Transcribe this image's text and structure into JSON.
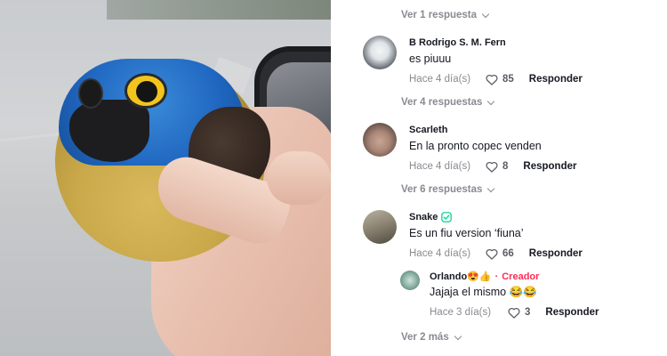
{
  "comments_panel": {
    "view_more": [
      {
        "label": "Ver 1 respuesta"
      },
      {
        "label": "Ver 4 respuestas"
      },
      {
        "label": "Ver 6 respuestas"
      },
      {
        "label": "Ver 2 más"
      }
    ],
    "comments": [
      {
        "author": "B Rodrigo S. M. Fern",
        "text": "es piuuu",
        "date": "Hace 4 día(s)",
        "likes": "85",
        "reply_label": "Responder"
      },
      {
        "author": "Scarleth",
        "text": "En la pronto copec venden",
        "date": "Hace 4 día(s)",
        "likes": "8",
        "reply_label": "Responder"
      },
      {
        "author": "Snake",
        "text": "Es un fiu version ‘fiuna’",
        "date": "Hace 4 día(s)",
        "likes": "66",
        "reply_label": "Responder"
      },
      {
        "author": "Orlando😍👍",
        "separator": "·",
        "badge": "Creador",
        "text": "Jajaja el mismo 😂😂",
        "date": "Hace 3 día(s)",
        "likes": "3",
        "reply_label": "Responder"
      }
    ]
  },
  "colors": {
    "accent": "#fe2c55",
    "verified": "#20d5a0",
    "muted": "#8a8b91"
  },
  "icons": {
    "like": "heart-outline-icon",
    "expand": "chevron-down-icon",
    "verified": "verified-badge-icon"
  }
}
